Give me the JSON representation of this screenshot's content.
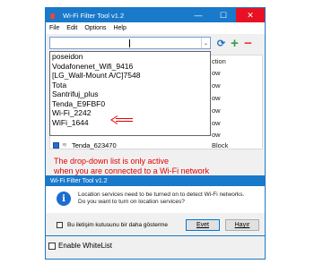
{
  "window": {
    "title": "Wi-Fi Filter Tool v1.2",
    "controls": {
      "minimize": "—",
      "maximize": "☐",
      "close": "✕"
    }
  },
  "menu": [
    "File",
    "Edit",
    "Options",
    "Help"
  ],
  "toolbar": {
    "combo_arrow": "⌄",
    "refresh_icon": "⟳",
    "add_icon": "+",
    "remove_icon": "−"
  },
  "list": {
    "action_header": "ction",
    "actions": [
      "ow",
      "ow",
      "ow",
      "ow",
      "ow",
      "ow"
    ],
    "bottom_row": {
      "name": "Tenda_623470",
      "action": "Block"
    }
  },
  "dropdown_items": [
    "poseidon",
    "Vodafonenet_Wifi_9416",
    "[LG_Wall-Mount A/C]7548",
    "Tota",
    "Santrifuj_plus",
    "Tenda_E9FBF0",
    "Wi-Fi_2242",
    "WiFi_1644"
  ],
  "annotation": {
    "line1": "The drop-down list  is only active",
    "line2": "when you are connected to a Wi-Fi network",
    "color": "#e60000"
  },
  "dialog": {
    "title": "Wi-Fi Filter Tool v1.2",
    "message_line1": "Location services need to be turned on to detect Wi-Fi networks.",
    "message_line2": "Do you want to turn on location services?",
    "checkbox_label": "Bu iletişim kutusunu bir daha gösterme",
    "yes_label": "Evet",
    "no_label": "Hayır"
  },
  "whitelist_label": "Enable WhiteList"
}
